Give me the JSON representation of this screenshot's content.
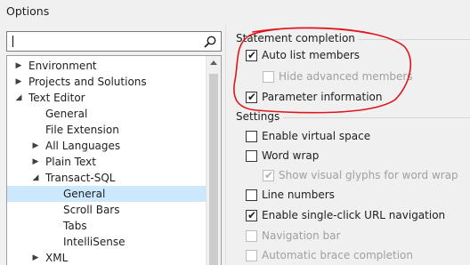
{
  "window": {
    "title": "Options"
  },
  "search": {
    "value": ""
  },
  "tree": {
    "items": [
      {
        "label": "Environment",
        "expander": "▶"
      },
      {
        "label": "Projects and Solutions",
        "expander": "▶"
      },
      {
        "label": "Text Editor",
        "expander": "◢"
      },
      {
        "label": "General",
        "expander": ""
      },
      {
        "label": "File Extension",
        "expander": ""
      },
      {
        "label": "All Languages",
        "expander": "▶"
      },
      {
        "label": "Plain Text",
        "expander": "▶"
      },
      {
        "label": "Transact-SQL",
        "expander": "◢"
      },
      {
        "label": "General",
        "expander": "",
        "selected": true
      },
      {
        "label": "Scroll Bars",
        "expander": ""
      },
      {
        "label": "Tabs",
        "expander": ""
      },
      {
        "label": "IntelliSense",
        "expander": ""
      },
      {
        "label": "XML",
        "expander": "▶"
      }
    ]
  },
  "statement_completion": {
    "title": "Statement completion",
    "auto_list_members": {
      "label": "Auto list members",
      "checked": true
    },
    "hide_advanced_members": {
      "label": "Hide advanced members",
      "checked": false,
      "enabled": false
    },
    "parameter_information": {
      "label": "Parameter information",
      "checked": true
    }
  },
  "settings": {
    "title": "Settings",
    "enable_virtual_space": {
      "label": "Enable virtual space",
      "checked": false
    },
    "word_wrap": {
      "label": "Word wrap",
      "checked": false
    },
    "show_visual_glyphs": {
      "label": "Show visual glyphs for word wrap",
      "checked": true,
      "enabled": false
    },
    "line_numbers": {
      "label": "Line numbers",
      "checked": false
    },
    "single_click_url": {
      "label": "Enable single-click URL navigation",
      "checked": true
    },
    "navigation_bar": {
      "label": "Navigation bar",
      "checked": false,
      "enabled": false
    },
    "auto_brace": {
      "label": "Automatic brace completion",
      "checked": false,
      "enabled": false
    }
  },
  "colors": {
    "selected_row": "#cce8ff",
    "annotation": "#e0141b"
  }
}
